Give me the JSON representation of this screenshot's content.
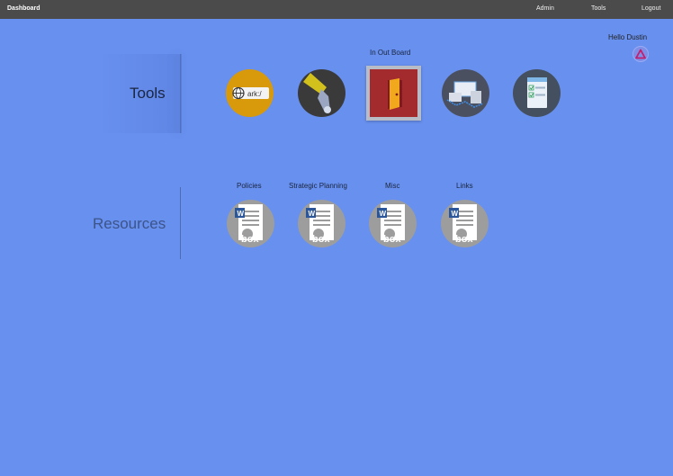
{
  "topbar": {
    "brand": "Dashboard",
    "links": [
      "Admin",
      "Tools",
      "Logout"
    ]
  },
  "user": {
    "greeting": "Hello Dustin",
    "avatar_icon": "triangle-logo-icon"
  },
  "tools": {
    "title": "Tools",
    "items": [
      {
        "icon": "ark-globe-icon",
        "label": ""
      },
      {
        "icon": "flashlight-icon",
        "label": ""
      },
      {
        "icon": "door-icon",
        "label": "In Out Board",
        "selected": true
      },
      {
        "icon": "devices-icon",
        "label": ""
      },
      {
        "icon": "checklist-icon",
        "label": ""
      }
    ]
  },
  "resources": {
    "title": "Resources",
    "items": [
      {
        "label": "Policies",
        "icon": "word-box-document-icon"
      },
      {
        "label": "Strategic Planning",
        "icon": "word-box-document-icon"
      },
      {
        "label": "Misc",
        "icon": "word-box-document-icon"
      },
      {
        "label": "Links",
        "icon": "word-box-document-icon"
      }
    ]
  },
  "colors": {
    "background": "#6890EE",
    "topbar": "#4B4B4B",
    "resource_circle": "#9D9D9D"
  }
}
